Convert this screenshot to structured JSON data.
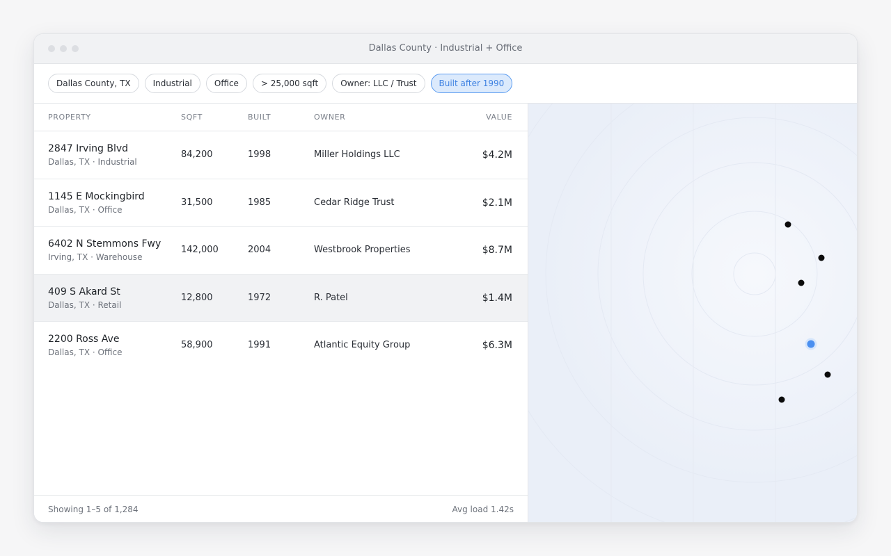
{
  "window": {
    "title": "Dallas County · Industrial + Office"
  },
  "filters": [
    {
      "label": "Dallas County, TX",
      "active": false
    },
    {
      "label": "Industrial",
      "active": false
    },
    {
      "label": "Office",
      "active": false
    },
    {
      "label": "> 25,000 sqft",
      "active": false
    },
    {
      "label": "Owner: LLC / Trust",
      "active": false
    },
    {
      "label": "Built after 1990",
      "active": true
    }
  ],
  "table": {
    "headers": {
      "property": "PROPERTY",
      "sqft": "SQFT",
      "built": "BUILT",
      "owner": "OWNER",
      "value": "VALUE"
    },
    "rows": [
      {
        "address": "2847 Irving Blvd",
        "sub": "Dallas, TX · Industrial",
        "sqft": "84,200",
        "built": "1998",
        "owner": "Miller Holdings LLC",
        "value": "$4.2M",
        "highlighted": false
      },
      {
        "address": "1145 E Mockingbird",
        "sub": "Dallas, TX · Office",
        "sqft": "31,500",
        "built": "1985",
        "owner": "Cedar Ridge Trust",
        "value": "$2.1M",
        "highlighted": false
      },
      {
        "address": "6402 N Stemmons Fwy",
        "sub": "Irving, TX · Warehouse",
        "sqft": "142,000",
        "built": "2004",
        "owner": "Westbrook Properties",
        "value": "$8.7M",
        "highlighted": false
      },
      {
        "address": "409 S Akard St",
        "sub": "Dallas, TX · Retail",
        "sqft": "12,800",
        "built": "1972",
        "owner": "R. Patel",
        "value": "$1.4M",
        "highlighted": true
      },
      {
        "address": "2200 Ross Ave",
        "sub": "Dallas, TX · Office",
        "sqft": "58,900",
        "built": "1991",
        "owner": "Atlantic Equity Group",
        "value": "$6.3M",
        "highlighted": false
      }
    ]
  },
  "footer": {
    "showing": "Showing 1–5 of 1,284",
    "avg_load": "Avg load 1.42s"
  },
  "colors": {
    "accent": "#3f82e2",
    "chip_active_bg": "#dceafc",
    "map_bg": "#eef2f9",
    "marker": "#0b0b0b",
    "marker_selected": "#4a8ff0"
  },
  "map": {
    "markers": [
      {
        "selected": false
      },
      {
        "selected": false
      },
      {
        "selected": false
      },
      {
        "selected": true
      },
      {
        "selected": false
      },
      {
        "selected": false
      }
    ]
  }
}
